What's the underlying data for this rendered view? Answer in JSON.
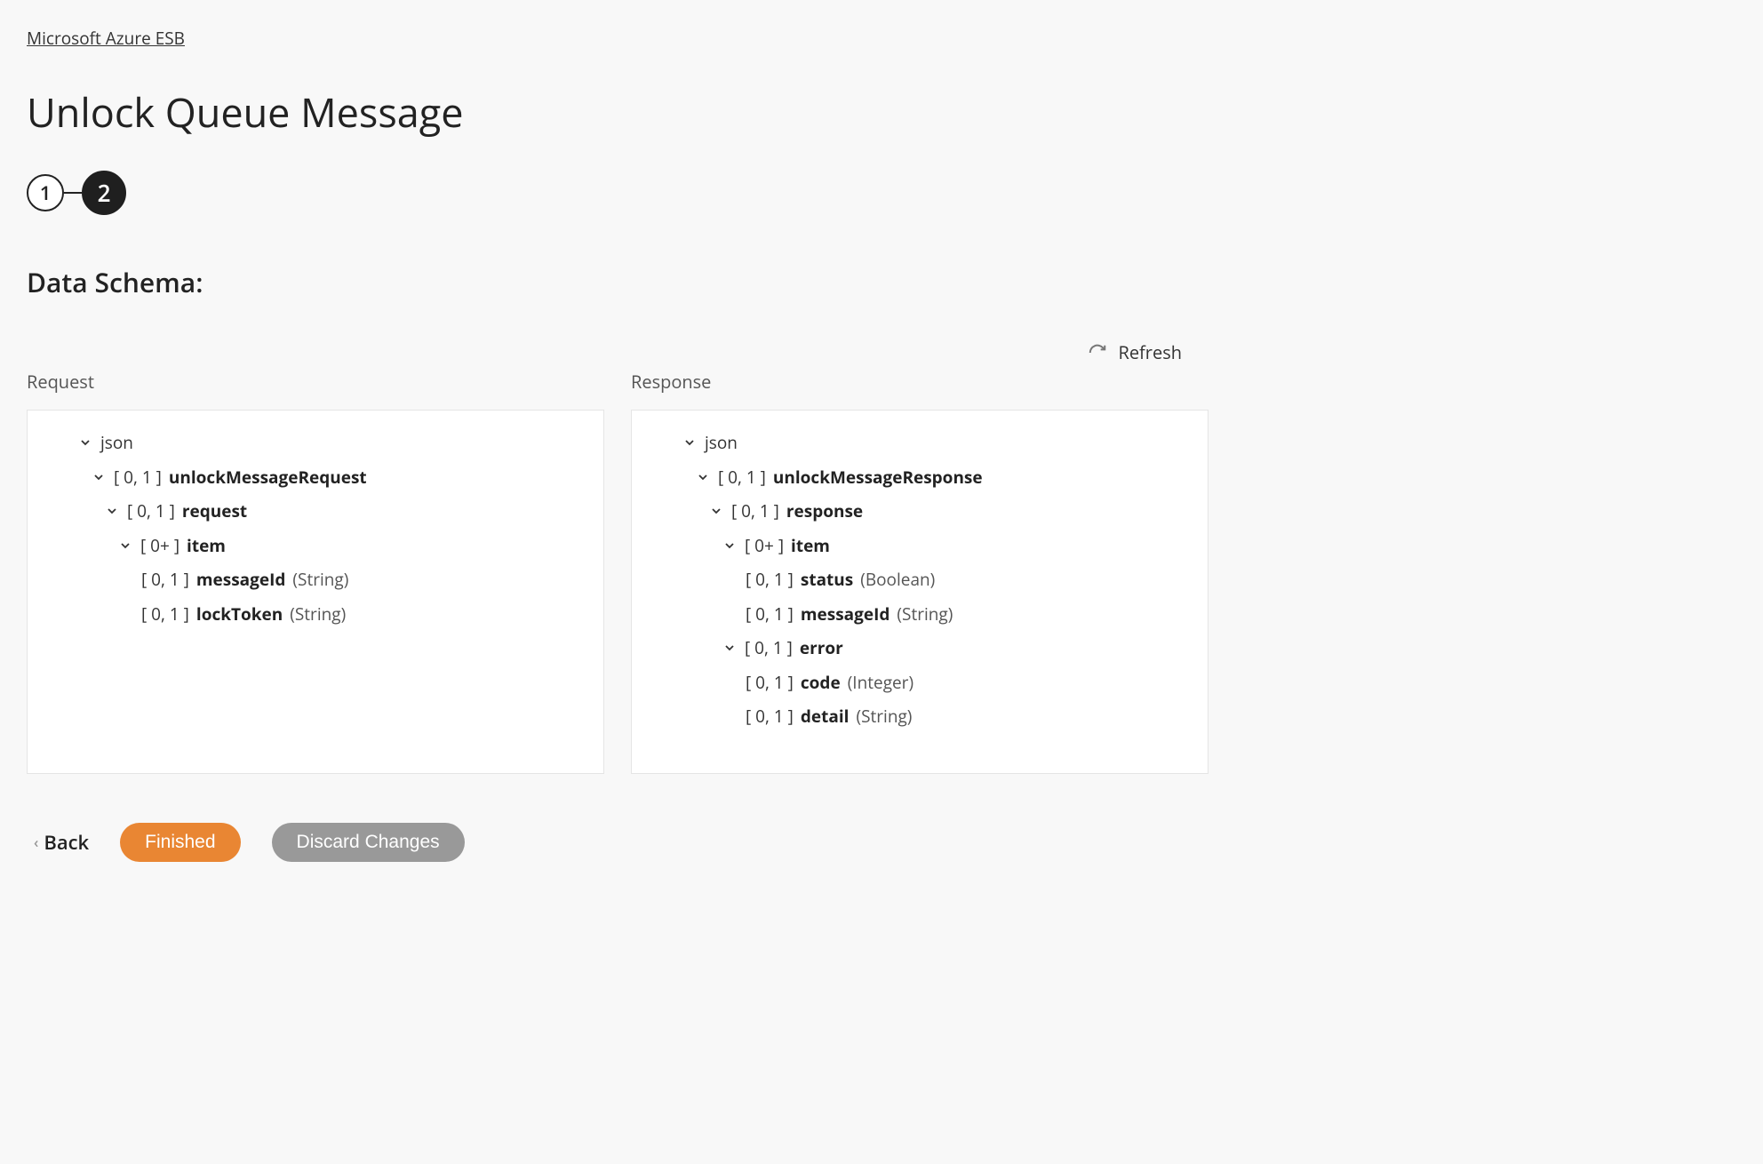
{
  "breadcrumb": "Microsoft Azure ESB",
  "title": "Unlock Queue Message",
  "stepper": {
    "step1": "1",
    "step2": "2"
  },
  "section": "Data Schema:",
  "refresh": "Refresh",
  "panels": {
    "request_label": "Request",
    "response_label": "Response"
  },
  "request": {
    "root": "json",
    "l1_card": "[ 0, 1 ]",
    "l1_name": "unlockMessageRequest",
    "l2_card": "[ 0, 1 ]",
    "l2_name": "request",
    "l3_card": "[ 0+ ]",
    "l3_name": "item",
    "f1_card": "[ 0, 1 ]",
    "f1_name": "messageId",
    "f1_type": "(String)",
    "f2_card": "[ 0, 1 ]",
    "f2_name": "lockToken",
    "f2_type": "(String)"
  },
  "response": {
    "root": "json",
    "l1_card": "[ 0, 1 ]",
    "l1_name": "unlockMessageResponse",
    "l2_card": "[ 0, 1 ]",
    "l2_name": "response",
    "l3_card": "[ 0+ ]",
    "l3_name": "item",
    "f1_card": "[ 0, 1 ]",
    "f1_name": "status",
    "f1_type": "(Boolean)",
    "f2_card": "[ 0, 1 ]",
    "f2_name": "messageId",
    "f2_type": "(String)",
    "err_card": "[ 0, 1 ]",
    "err_name": "error",
    "e1_card": "[ 0, 1 ]",
    "e1_name": "code",
    "e1_type": "(Integer)",
    "e2_card": "[ 0, 1 ]",
    "e2_name": "detail",
    "e2_type": "(String)"
  },
  "footer": {
    "back": "Back",
    "finished": "Finished",
    "discard": "Discard Changes"
  }
}
